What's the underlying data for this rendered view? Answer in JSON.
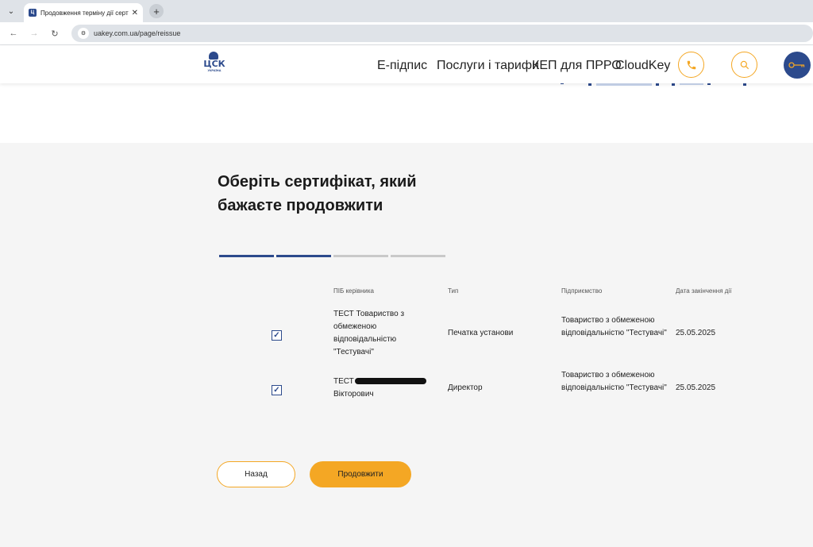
{
  "browser": {
    "tab_title": "Продовження терміну дії сертифіката",
    "url": "uakey.com.ua/page/reissue"
  },
  "header": {
    "logo_text": "ЦСК",
    "logo_sub": "УКРАЇНА",
    "nav": [
      "Е-підпис",
      "Послуги і тарифи",
      "КЕП для ПРРО",
      "CloudKey"
    ]
  },
  "main": {
    "title": "Оберіть сертифікат, який бажаєте продовжити",
    "steps_total": 4,
    "steps_completed": 2
  },
  "table": {
    "headers": [
      "ПІБ керівника",
      "Тип",
      "Підприємство",
      "Дата закінчення дії"
    ],
    "rows": [
      {
        "checked": true,
        "name": "ТЕСТ Товариство з обмеженою відповідальністю \"Тестувачі\"",
        "type": "Печатка установи",
        "company": "Товариство з обмеженою відповідальністю \"Тестувачі\"",
        "date": "25.05.2025"
      },
      {
        "checked": true,
        "name_prefix": "ТЕСТ",
        "name_suffix": "Вікторович",
        "type": "Директор",
        "company": "Товариство з обмеженою відповідальністю \"Тестувачі\"",
        "date": "25.05.2025"
      }
    ]
  },
  "buttons": {
    "back": "Назад",
    "continue": "Продовжити"
  },
  "colors": {
    "accent": "#f4a724",
    "brand": "#2c4a8c"
  }
}
